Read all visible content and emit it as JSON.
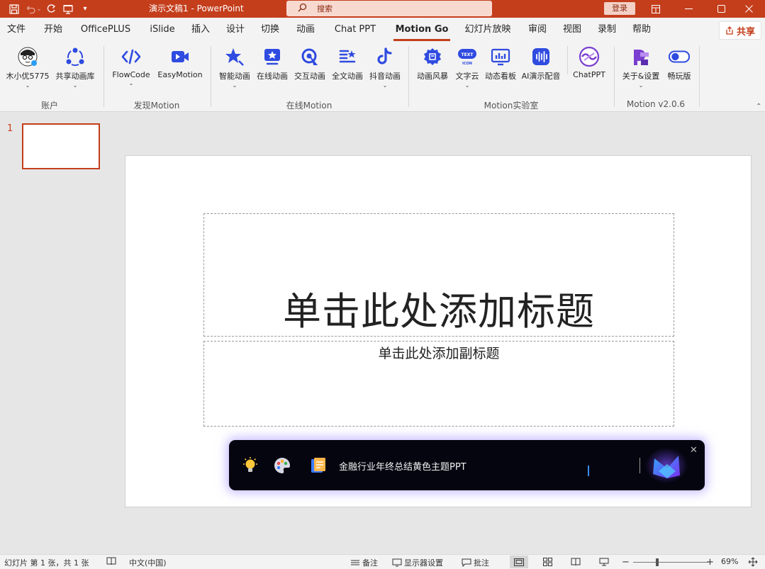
{
  "colors": {
    "accent": "#c43e1c",
    "ribbon_bg": "#f3f3f3",
    "canvas_bg": "#e6e6e6",
    "motion_blue": "#2f4be0",
    "ai_bar_bg": "#050510"
  },
  "titlebar": {
    "qat": [
      "save-icon",
      "undo-icon",
      "redo-icon",
      "present-icon",
      "customize-icon"
    ],
    "doc_title": "演示文稿1  -  PowerPoint",
    "search_placeholder": "搜索",
    "login_label": "登录",
    "window_controls": [
      "ribbon-display-icon",
      "minimize-icon",
      "maximize-icon",
      "close-icon"
    ]
  },
  "tabs": [
    {
      "label": "文件"
    },
    {
      "label": "开始"
    },
    {
      "label": "OfficePLUS"
    },
    {
      "label": "iSlide"
    },
    {
      "label": "插入"
    },
    {
      "label": "设计"
    },
    {
      "label": "切换"
    },
    {
      "label": "动画"
    },
    {
      "label": "Chat PPT"
    },
    {
      "label": "Motion Go",
      "active": true
    },
    {
      "label": "幻灯片放映"
    },
    {
      "label": "审阅"
    },
    {
      "label": "视图"
    },
    {
      "label": "录制"
    },
    {
      "label": "帮助"
    }
  ],
  "share_label": "共享",
  "ribbon": {
    "groups": [
      {
        "label": "账户",
        "buttons": [
          {
            "label": "木小优5775",
            "icon": "avatar-icon",
            "dropdown": true
          },
          {
            "label": "共享动画库",
            "icon": "share-library-icon",
            "dropdown": true
          }
        ]
      },
      {
        "label": "发现Motion",
        "buttons": [
          {
            "label": "FlowCode",
            "icon": "code-icon",
            "dropdown": true
          },
          {
            "label": "EasyMotion",
            "icon": "video-icon",
            "dropdown": false
          }
        ]
      },
      {
        "label": "在线Motion",
        "buttons": [
          {
            "label": "智能动画",
            "icon": "magic-star-icon",
            "dropdown": true
          },
          {
            "label": "在线动画",
            "icon": "online-anim-icon",
            "dropdown": false
          },
          {
            "label": "交互动画",
            "icon": "interactive-icon",
            "dropdown": false
          },
          {
            "label": "全文动画",
            "icon": "fulltext-icon",
            "dropdown": false
          },
          {
            "label": "抖音动画",
            "icon": "tiktok-icon",
            "dropdown": true
          }
        ]
      },
      {
        "label": "Motion实验室",
        "buttons": [
          {
            "label": "动画风暴",
            "icon": "storm-icon",
            "dropdown": false
          },
          {
            "label": "文字云",
            "icon": "text-icon-badge",
            "badge_top": "TEXT",
            "badge_bottom": "ICON",
            "dropdown": true
          },
          {
            "label": "动态看板",
            "icon": "dashboard-icon",
            "dropdown": false
          },
          {
            "label": "AI演示配音",
            "icon": "voice-icon",
            "dropdown": false
          },
          {
            "label": "ChatPPT",
            "icon": "chatppt-icon",
            "dropdown": false
          }
        ]
      },
      {
        "label": "Motion v2.0.6",
        "buttons": [
          {
            "label": "关于&设置",
            "icon": "about-icon",
            "dropdown": true
          },
          {
            "label": "畅玩版",
            "icon": "toggle-icon",
            "dropdown": false
          }
        ]
      }
    ]
  },
  "thumbnails": [
    {
      "number": "1"
    }
  ],
  "slide": {
    "title_placeholder": "单击此处添加标题",
    "subtitle_placeholder": "单击此处添加副标题"
  },
  "ai_bar": {
    "icons": [
      "lightbulb-icon",
      "palette-icon",
      "document-icon"
    ],
    "input_text": "金融行业年终总结黄色主题PPT"
  },
  "statusbar": {
    "slide_info": "幻灯片 第 1 张，共 1 张",
    "language": "中文(中国)",
    "notes_label": "备注",
    "display_label": "显示器设置",
    "comments_label": "批注",
    "zoom": "69%"
  }
}
